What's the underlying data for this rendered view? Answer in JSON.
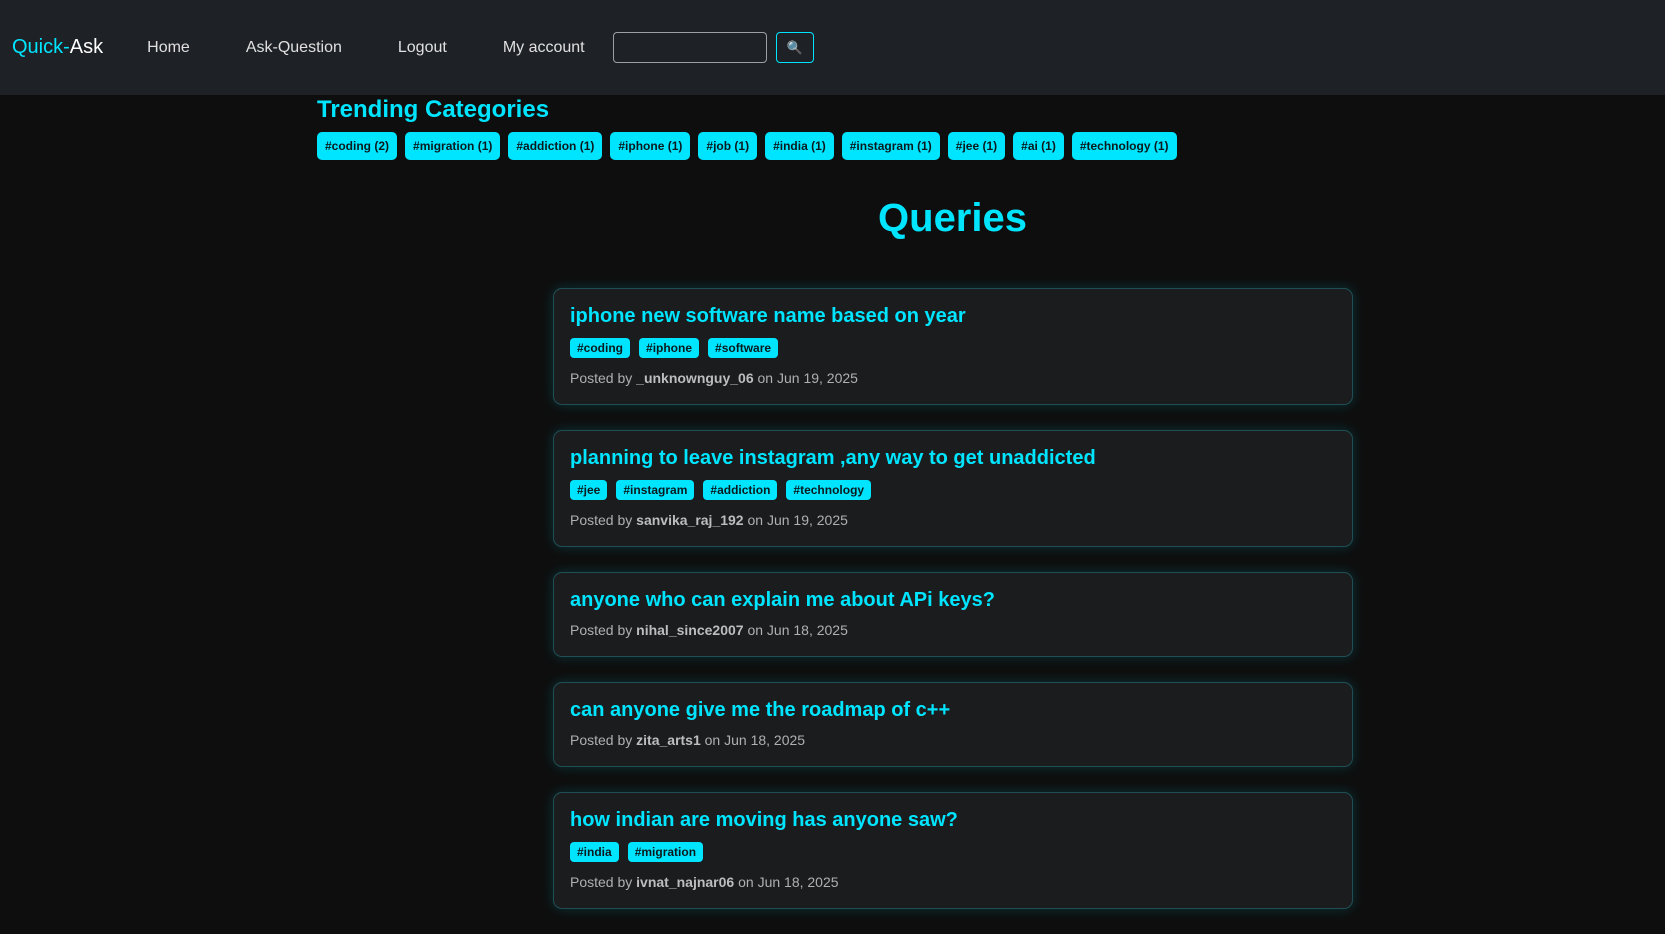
{
  "navbar": {
    "brand_part1": "Quick",
    "brand_sep": "-",
    "brand_part2": "Ask",
    "links": [
      "Home",
      "Ask-Question",
      "Logout",
      "My account"
    ],
    "search_placeholder": "",
    "search_icon": "magnifier-icon",
    "search_glyph": "🔍"
  },
  "trending": {
    "title": "Trending Categories",
    "categories": [
      "#coding (2)",
      "#migration (1)",
      "#addiction (1)",
      "#iphone (1)",
      "#job (1)",
      "#india (1)",
      "#instagram (1)",
      "#jee (1)",
      "#ai (1)",
      "#technology (1)"
    ]
  },
  "queries": {
    "title": "Queries",
    "posted_by_label": "Posted by",
    "on_label": "on",
    "items": [
      {
        "title": "iphone new software name based on year",
        "tags": [
          "#coding",
          "#iphone",
          "#software"
        ],
        "author": "_unknownguy_06",
        "date": "Jun 19, 2025"
      },
      {
        "title": "planning to leave instagram ,any way to get unaddicted",
        "tags": [
          "#jee",
          "#instagram",
          "#addiction",
          "#technology"
        ],
        "author": "sanvika_raj_192",
        "date": "Jun 19, 2025"
      },
      {
        "title": "anyone who can explain me about APi keys?",
        "tags": [],
        "author": "nihal_since2007",
        "date": "Jun 18, 2025"
      },
      {
        "title": "can anyone give me the roadmap of c++",
        "tags": [],
        "author": "zita_arts1",
        "date": "Jun 18, 2025"
      },
      {
        "title": "how indian are moving has anyone saw?",
        "tags": [
          "#india",
          "#migration"
        ],
        "author": "ivnat_najnar06",
        "date": "Jun 18, 2025"
      }
    ]
  },
  "colors": {
    "accent": "#00e5ff",
    "navbar_bg": "#1e2125",
    "page_bg": "#0e0e0e",
    "card_bg": "#1b1c1e"
  }
}
